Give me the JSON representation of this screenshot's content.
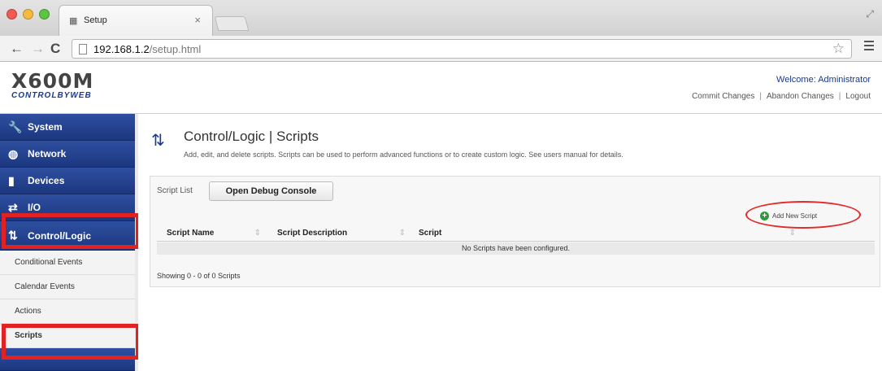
{
  "browser": {
    "tab_title": "Setup",
    "url_host": "192.168.1.2",
    "url_path": "/setup.html"
  },
  "header": {
    "logo_main": "X600M",
    "logo_sub": "CONTROLBYWEB",
    "welcome": "Welcome: Administrator",
    "links": [
      "Commit Changes",
      "Abandon Changes",
      "Logout"
    ]
  },
  "sidebar": {
    "items": [
      {
        "label": "System",
        "icon": "wrench-icon"
      },
      {
        "label": "Network",
        "icon": "globe-icon"
      },
      {
        "label": "Devices",
        "icon": "device-icon"
      },
      {
        "label": "I/O",
        "icon": "io-arrows-icon"
      },
      {
        "label": "Control/Logic",
        "icon": "logic-icon"
      }
    ],
    "subitems": [
      "Conditional Events",
      "Calendar Events",
      "Actions",
      "Scripts"
    ]
  },
  "main": {
    "title": "Control/Logic | Scripts",
    "description": "Add, edit, and delete scripts. Scripts can be used to perform advanced functions or to create custom logic. See users manual for details.",
    "panel": {
      "label": "Script List",
      "debug_button": "Open Debug Console",
      "add_button": "Add New Script",
      "columns": [
        "Script Name",
        "Script Description",
        "Script"
      ],
      "empty_message": "No Scripts have been configured.",
      "showing": "Showing 0 - 0 of 0 Scripts"
    }
  },
  "colors": {
    "accent": "#1c3780",
    "highlight": "#e22222"
  }
}
